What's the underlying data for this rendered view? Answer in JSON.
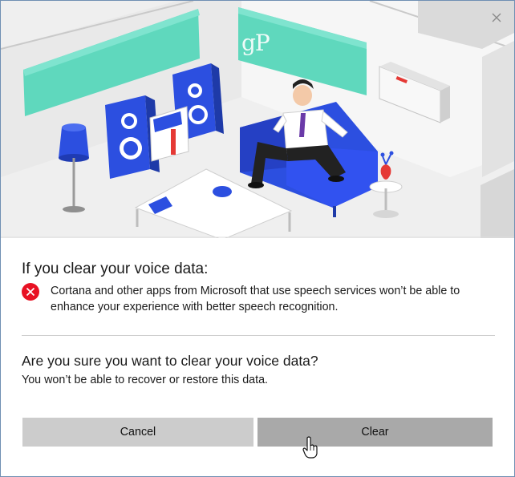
{
  "window": {
    "close_icon": "close-icon"
  },
  "hero": {
    "watermark": "gP",
    "colors": {
      "mint": "#5fd8bd",
      "blue": "#2c4fe0",
      "red": "#e53935"
    }
  },
  "warning_section": {
    "heading": "If you clear your voice data:",
    "icon": "error-x-icon",
    "icon_color": "#e81123",
    "message": "Cortana and other apps from Microsoft that use speech services won’t be able to enhance your experience with better speech recognition."
  },
  "confirm_section": {
    "question": "Are you sure you want to clear your voice data?",
    "note": "You won’t be able to recover or restore this data."
  },
  "buttons": {
    "cancel_label": "Cancel",
    "clear_label": "Clear"
  },
  "pointer": {
    "icon": "hand-pointer-icon"
  }
}
